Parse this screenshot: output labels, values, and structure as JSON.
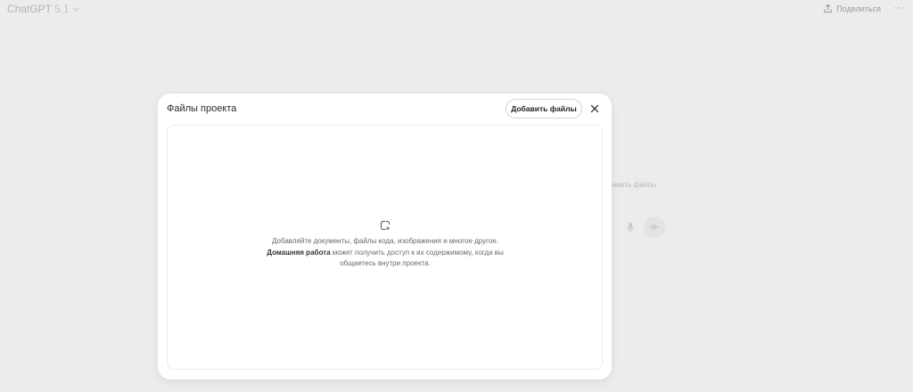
{
  "header": {
    "model_name": "ChatGPT",
    "model_version": "5.1",
    "share_label": "Поделиться",
    "more_label": "···"
  },
  "background": {
    "add_files_label": "бавить файлы"
  },
  "modal": {
    "title": "Файлы проекта",
    "add_files_label": "Добавить файлы",
    "dropzone": {
      "text_before": "Добавляйте документы, файлы кода, изображения и многое другое.",
      "project_name": "Домашняя работа",
      "text_after": "может получить доступ к их содержимому, когда вы общаетесь внутри проекта."
    }
  },
  "icons": {
    "chevron": "chevron-down-icon",
    "share": "share-icon",
    "close": "close-icon",
    "drop": "add-file-icon",
    "mic": "microphone-icon",
    "voice": "voice-wave-icon"
  }
}
